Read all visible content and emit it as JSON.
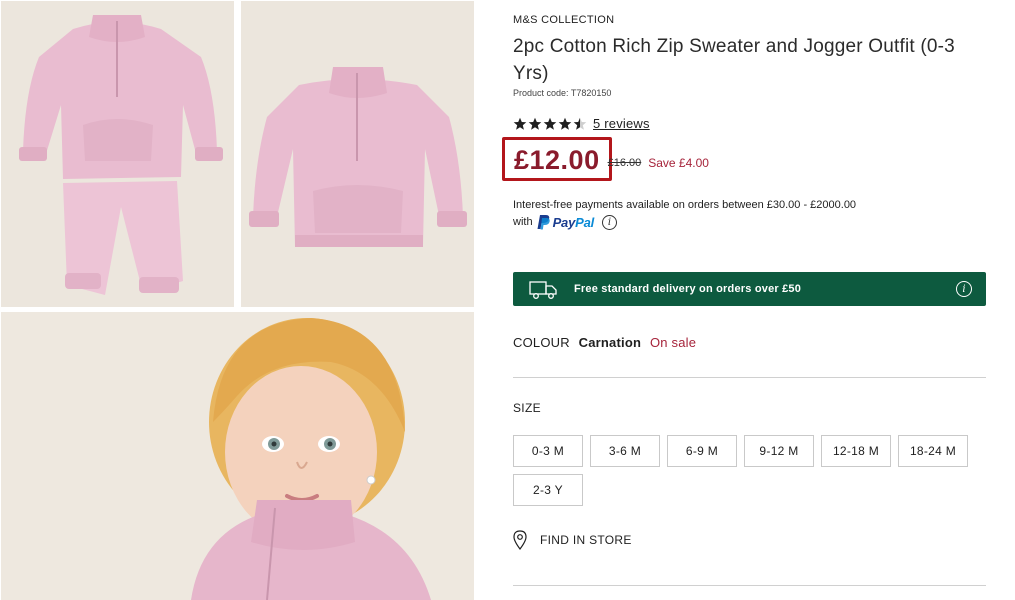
{
  "gallery": {
    "images": [
      {
        "alt_icon": "outfit-flatlay-image"
      },
      {
        "alt_icon": "sweater-flatlay-image"
      },
      {
        "alt_icon": "toddler-model-image"
      }
    ]
  },
  "product": {
    "brand": "M&S COLLECTION",
    "title": "2pc Cotton Rich Zip Sweater and Jogger Outfit (0-3 Yrs)",
    "code": "Product code: T7820150",
    "rating_value": 4.5,
    "rating_max": 5,
    "reviews_label": "5 reviews",
    "price_now": "£12.00",
    "price_was": "£16.00",
    "price_save": "Save £4.00",
    "credit_text": "Interest-free payments available on orders between £30.00 - £2000.00",
    "paypal_with": "with",
    "paypal_pay": "Pay",
    "paypal_pal": "Pal",
    "delivery_text": "Free standard delivery on orders over £50",
    "colour_label": "COLOUR",
    "colour_value": "Carnation",
    "colour_sale": "On sale",
    "size_label": "SIZE",
    "sizes": [
      "0-3 M",
      "3-6 M",
      "6-9 M",
      "9-12 M",
      "12-18 M",
      "18-24 M",
      "2-3 Y"
    ],
    "find_in_store": "FIND IN STORE"
  },
  "colors": {
    "price": "#8a1b2c",
    "highlight_box": "#b3161b",
    "sale": "#a6243b",
    "delivery_bg": "#0d5a3f",
    "paypal_dark": "#1b3d8f",
    "paypal_light": "#0a8ad6",
    "garment_pink": "#e9bcd0",
    "photo_bg": "#ece6dd"
  }
}
